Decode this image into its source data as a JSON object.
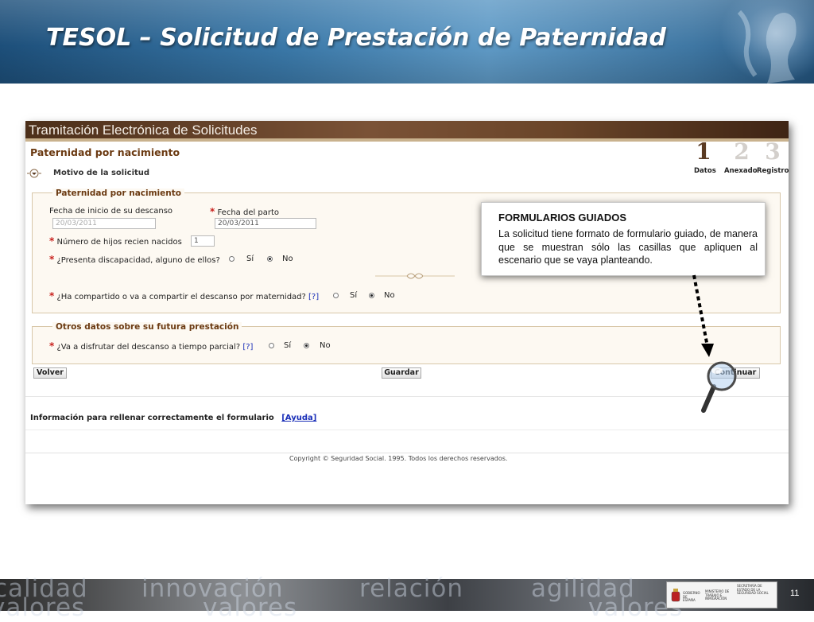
{
  "slide": {
    "title": "TESOL – Solicitud de Prestación de Paternidad",
    "page_number": "11"
  },
  "app": {
    "header_title": "Tramitación Electrónica de Solicitudes",
    "page_heading": "Paternidad por nacimiento",
    "section_toggle_label": "Motivo de la solicitud",
    "steps": [
      {
        "num": "1",
        "label": "Datos",
        "active": true
      },
      {
        "num": "2",
        "label": "Anexado",
        "active": false
      },
      {
        "num": "3",
        "label": "Registro",
        "active": false
      }
    ]
  },
  "form": {
    "section1_title": "Paternidad por nacimiento",
    "fecha_inicio_label": "Fecha de inicio de su descanso",
    "fecha_inicio_value": "20/03/2011",
    "fecha_parto_label": "Fecha del parto",
    "fecha_parto_value": "20/03/2011",
    "hijos_label": "Número de hijos recien nacidos",
    "hijos_value": "1",
    "discapacidad_label": "¿Presenta discapacidad, alguno de ellos?",
    "compartido_label": "¿Ha compartido o va a compartir el descanso por maternidad?",
    "section2_title": "Otros datos sobre su futura prestación",
    "tiempo_parcial_label": "¿Va a disfrutar del descanso a tiempo parcial?",
    "help_link": "[?]",
    "option_si": "Sí",
    "option_no": "No",
    "required_mark": "*",
    "selected_option": "No"
  },
  "buttons": {
    "volver": "Volver",
    "guardar": "Guardar",
    "continuar": "Continuar"
  },
  "info": {
    "text": "Información para rellenar correctamente el formulario",
    "link": "[Ayuda]",
    "copyright": "Copyright © Seguridad Social. 1995. Todos los derechos reservados."
  },
  "callout": {
    "title": "FORMULARIOS GUIADOS",
    "body": "La solicitud tiene formato de formulario guiado, de manera que se muestran sólo las casillas que apliquen al escenario que se vaya planteando."
  },
  "footer": {
    "words": [
      "calidad",
      "innovación",
      "relación",
      "agilidad",
      "valores",
      "valores",
      "valores"
    ],
    "logo_lines": [
      "GOBIERNO DE ESPAÑA",
      "MINISTERIO DE TRABAJO E INMIGRACIÓN",
      "SECRETARÍA DE ESTADO DE LA SEGURIDAD SOCIAL"
    ]
  },
  "colors": {
    "banner_blue": "#3a78a8",
    "app_header_brown": "#6a4529",
    "section_title_brown": "#6b3a12",
    "required_red": "#c8201c",
    "link_blue": "#1a2fb8"
  },
  "icons": [
    "collapse-toggle-icon",
    "magnifier-icon",
    "dotted-arrow-icon",
    "ornament-icon",
    "coat-of-arms-icon"
  ]
}
